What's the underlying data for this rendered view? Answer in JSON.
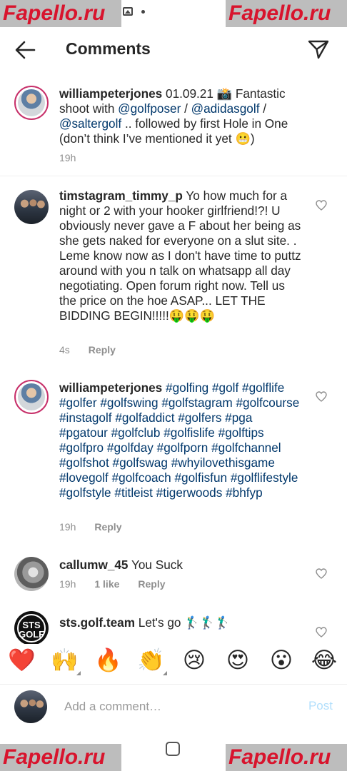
{
  "watermark": "Fapello.ru",
  "header": {
    "title": "Comments"
  },
  "comments": [
    {
      "username": "williampeterjones",
      "body_parts": [
        {
          "t": " 01.09.21 📸 Fantastic shoot with ",
          "tag": false
        },
        {
          "t": "@golfposer",
          "tag": true
        },
        {
          "t": " / ",
          "tag": false
        },
        {
          "t": "@adidasgolf",
          "tag": true
        },
        {
          "t": " / ",
          "tag": false
        },
        {
          "t": "@saltergolf",
          "tag": true
        },
        {
          "t": " .. followed by first Hole in One (don’t think I’ve mentioned it yet 😬)",
          "tag": false
        }
      ],
      "time": "19h"
    },
    {
      "username": "timstagram_timmy_p",
      "body": " Yo how much for a night or 2 with your hooker girlfriend!?! U obviously never gave a F about her being as she gets naked for everyone on a slut site. . Leme know now as I don't have time to puttz around with you n talk on whatsapp all day negotiating. Open forum right now. Tell us the price on the hoe ASAP... LET THE BIDDING BEGIN!!!!!🤑🤑🤑",
      "time": "4s",
      "reply": "Reply"
    },
    {
      "username": "williampeterjones",
      "hashtags": "#golfing #golf #golflife #golfer #golfswing #golfstagram #golfcourse #instagolf #golfaddict #golfers #pga #pgatour #golfclub #golfislife #golftips #golfpro #golfday #golfporn #golfchannel #golfshot #golfswag #whyilovethisgame #lovegolf #golfcoach #golfisfun #golflifestyle #golfstyle #titleist #tigerwoods #bhfyp",
      "time": "19h",
      "reply": "Reply"
    },
    {
      "username": "callumw_45",
      "body": " You Suck",
      "time": "19h",
      "likes": "1 like",
      "reply": "Reply"
    },
    {
      "username": "sts.golf.team",
      "body": " Let's go 🏌️‍♂️🏌️‍♂️🏌️‍♂️",
      "avatar_text": "STS GOLF"
    }
  ],
  "emoji_bar": [
    "❤️",
    "🙌",
    "🔥",
    "👏",
    "😢",
    "😍",
    "😮",
    "😂"
  ],
  "input": {
    "placeholder": "Add a comment…",
    "post_label": "Post"
  }
}
